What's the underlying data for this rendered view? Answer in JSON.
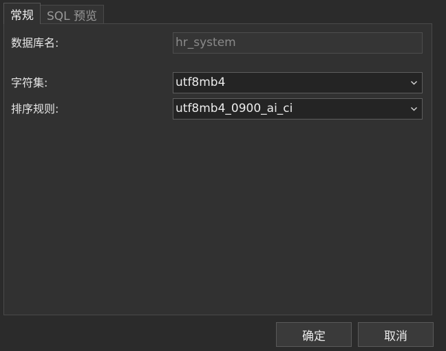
{
  "tabs": [
    {
      "label": "常规",
      "active": true
    },
    {
      "label": "SQL 预览",
      "active": false
    }
  ],
  "form": {
    "db_name": {
      "label": "数据库名:",
      "value": "hr_system",
      "disabled": true
    },
    "charset": {
      "label": "字符集:",
      "value": "utf8mb4"
    },
    "collation": {
      "label": "排序规则:",
      "value": "utf8mb4_0900_ai_ci"
    }
  },
  "buttons": {
    "ok": "确定",
    "cancel": "取消"
  },
  "icons": {
    "dropdown": "chevron-down-icon"
  },
  "colors": {
    "background": "#2b2b2b",
    "panel": "#313131",
    "input": "#242424",
    "text": "#e6e6e6",
    "disabled_text": "#8a8a8a"
  }
}
